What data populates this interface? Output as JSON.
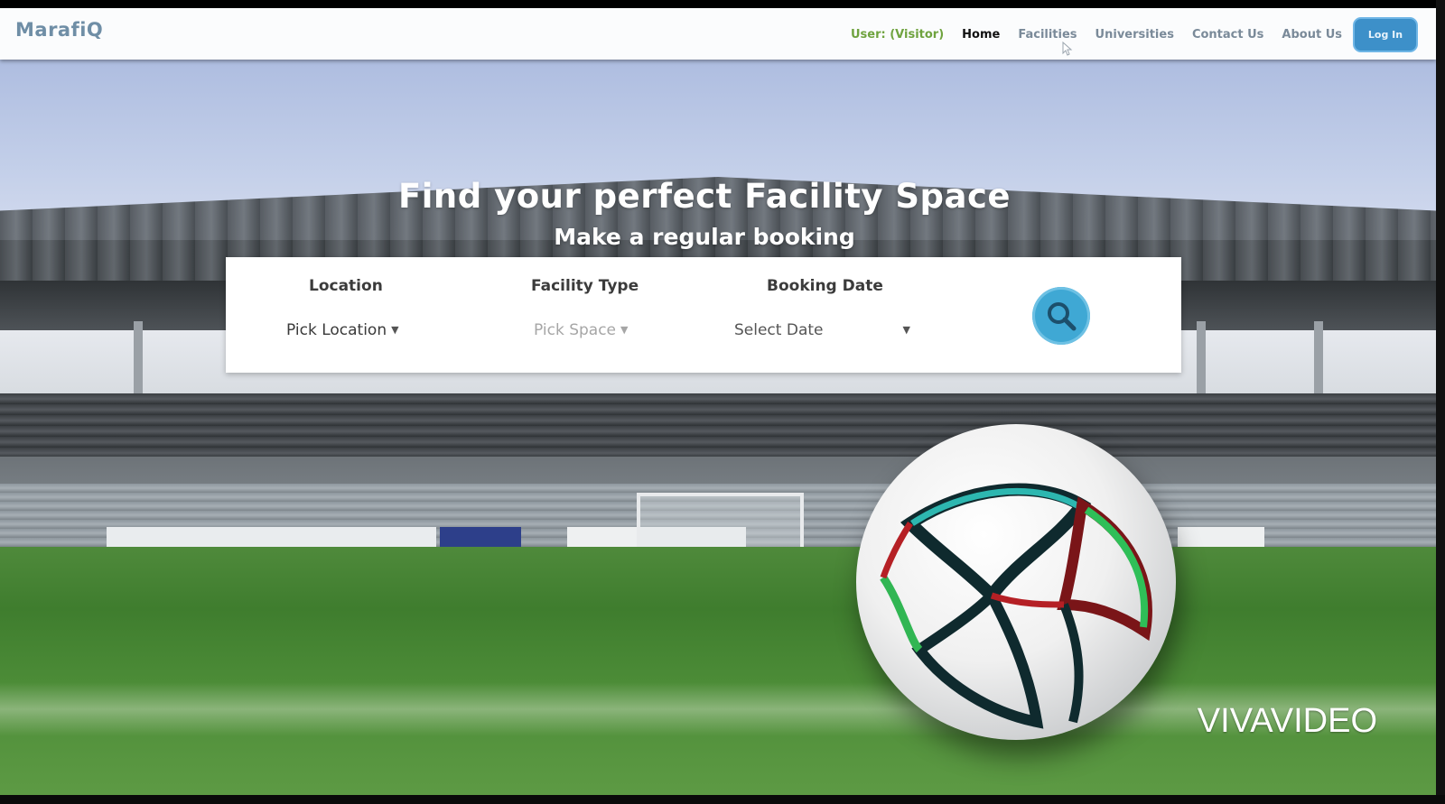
{
  "navbar": {
    "brand": "MarafiQ",
    "user_label": "User: (Visitor)",
    "links": [
      "Home",
      "Facilities",
      "Universities",
      "Contact Us",
      "About Us"
    ],
    "login_label": "Log In"
  },
  "hero": {
    "title": "Find your perfect Facility Space",
    "subtitle": "Make a regular booking"
  },
  "search": {
    "location": {
      "label": "Location",
      "value": "Pick Location"
    },
    "facility_type": {
      "label": "Facility Type",
      "value": "Pick Space"
    },
    "booking_date": {
      "label": "Booking Date",
      "value": "Select Date"
    },
    "search_icon": "search-icon"
  },
  "watermark": "VIVAVIDEO",
  "colors": {
    "brand": "#6f8ea6",
    "user_label": "#6fa33f",
    "login_button": "#3d90c9",
    "search_button": "#3fa8d4"
  }
}
